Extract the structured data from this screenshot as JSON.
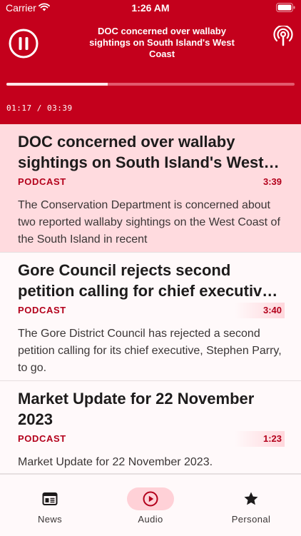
{
  "status_bar": {
    "carrier": "Carrier",
    "time": "1:26 AM"
  },
  "player": {
    "now_playing_title": "DOC concerned over wallaby sightings on South Island's West Coast",
    "elapsed": "01:17",
    "separator": "/",
    "total": "03:39",
    "progress_fraction": 0.352
  },
  "items": [
    {
      "title": "DOC concerned over wallaby sightings on South Island's West Coast",
      "tag": "PODCAST",
      "duration": "3:39",
      "summary": "The Conservation Department is concerned about two reported wallaby sightings on the West Coast of the South Island in recent"
    },
    {
      "title": "Gore Council rejects second petition calling for chief executive to go",
      "tag": "PODCAST",
      "duration": "3:40",
      "summary": "The Gore District Council has rejected a second petition calling for its chief executive, Stephen Parry, to go."
    },
    {
      "title": "Market Update for 22 November 2023",
      "tag": "PODCAST",
      "duration": "1:23",
      "summary": "Market Update for 22 November 2023."
    }
  ],
  "tabs": [
    {
      "label": "News",
      "icon": "newspaper-icon"
    },
    {
      "label": "Audio",
      "icon": "play-circle-icon",
      "selected": true
    },
    {
      "label": "Personal",
      "icon": "star-icon"
    }
  ],
  "colors": {
    "brand_red": "#c4001c",
    "accent_text": "#b3001b",
    "active_row": "#ffdbdf"
  }
}
